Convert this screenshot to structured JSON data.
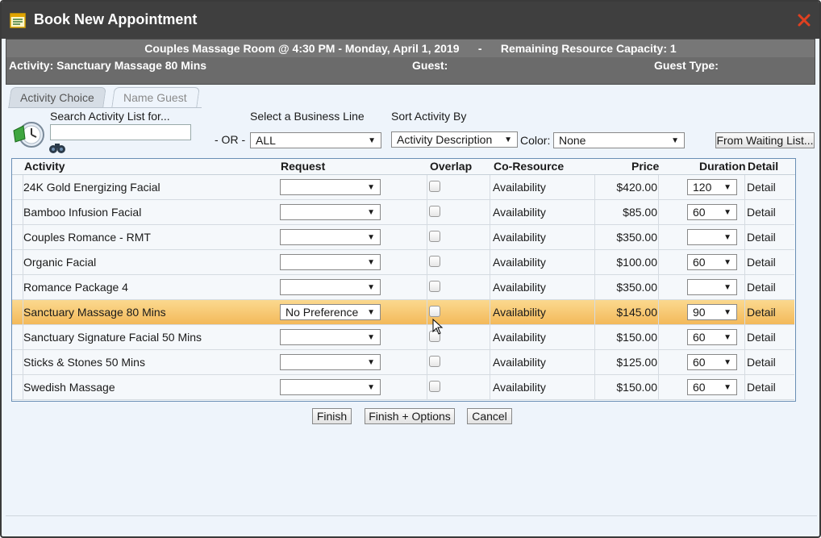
{
  "window": {
    "title": "Book New Appointment",
    "icon": "calendar-icon",
    "close_icon": "close-x-icon",
    "close_color": "#e04020"
  },
  "info": {
    "header_line": "Couples Massage Room @ 4:30 PM - Monday, April 1, 2019      -      Remaining Resource Capacity: 1",
    "activity": "Activity: Sanctuary Massage 80 Mins",
    "guest": "Guest:",
    "guest_type": "Guest Type:"
  },
  "tabs": {
    "activity_choice": "Activity Choice",
    "name_guest": "Name Guest"
  },
  "filters": {
    "search_label": "Search Activity List for...",
    "search_value": "",
    "or_label": "- OR -",
    "business_line_label": "Select a Business Line",
    "business_line_value": "ALL",
    "sort_label": "Sort Activity By",
    "sort_value": "Activity Description",
    "color_label": "Color:",
    "color_value": "None",
    "waiting_list_button": "From Waiting List..."
  },
  "table": {
    "headers": {
      "activity": "Activity",
      "request": "Request",
      "overlap": "Overlap",
      "co_resource": "Co-Resource",
      "price": "Price",
      "duration": "Duration",
      "detail": "Detail"
    },
    "rows": [
      {
        "activity": "24K Gold Energizing Facial",
        "request": "",
        "co_resource": "Availability",
        "price": "$420.00",
        "duration": "120",
        "detail": "Detail",
        "selected": false
      },
      {
        "activity": "Bamboo Infusion Facial",
        "request": "",
        "co_resource": "Availability",
        "price": "$85.00",
        "duration": "60",
        "detail": "Detail",
        "selected": false
      },
      {
        "activity": "Couples Romance - RMT",
        "request": "",
        "co_resource": "Availability",
        "price": "$350.00",
        "duration": "",
        "detail": "Detail",
        "selected": false
      },
      {
        "activity": "Organic Facial",
        "request": "",
        "co_resource": "Availability",
        "price": "$100.00",
        "duration": "60",
        "detail": "Detail",
        "selected": false
      },
      {
        "activity": "Romance Package 4",
        "request": "",
        "co_resource": "Availability",
        "price": "$350.00",
        "duration": "",
        "detail": "Detail",
        "selected": false
      },
      {
        "activity": "Sanctuary Massage 80 Mins",
        "request": "No Preference",
        "co_resource": "Availability",
        "price": "$145.00",
        "duration": "90",
        "detail": "Detail",
        "selected": true
      },
      {
        "activity": "Sanctuary Signature Facial 50 Mins",
        "request": "",
        "co_resource": "Availability",
        "price": "$150.00",
        "duration": "60",
        "detail": "Detail",
        "selected": false
      },
      {
        "activity": "Sticks & Stones 50 Mins",
        "request": "",
        "co_resource": "Availability",
        "price": "$125.00",
        "duration": "60",
        "detail": "Detail",
        "selected": false
      },
      {
        "activity": "Swedish Massage",
        "request": "",
        "co_resource": "Availability",
        "price": "$150.00",
        "duration": "60",
        "detail": "Detail",
        "selected": false
      }
    ]
  },
  "actions": {
    "finish": "Finish",
    "finish_options": "Finish + Options",
    "cancel": "Cancel"
  },
  "colors": {
    "titlebar": "#3f3f3f",
    "infobar": "#6b6b6b",
    "selected_row": "#f3b95a",
    "background": "#eef4fb"
  }
}
